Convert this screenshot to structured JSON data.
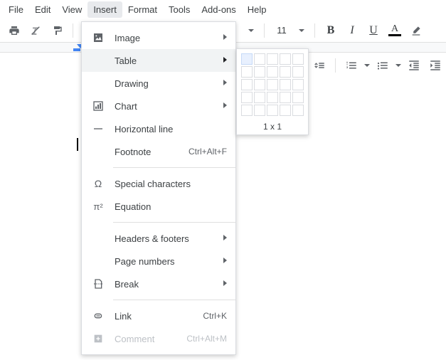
{
  "menubar": {
    "items": [
      {
        "label": "File"
      },
      {
        "label": "Edit"
      },
      {
        "label": "View"
      },
      {
        "label": "Insert"
      },
      {
        "label": "Format"
      },
      {
        "label": "Tools"
      },
      {
        "label": "Add-ons"
      },
      {
        "label": "Help"
      }
    ],
    "active_index": 3
  },
  "toolbar": {
    "font_size": "11"
  },
  "insert_menu": {
    "image": "Image",
    "table": "Table",
    "drawing": "Drawing",
    "chart": "Chart",
    "horizontal_line": "Horizontal line",
    "footnote": "Footnote",
    "footnote_shortcut": "Ctrl+Alt+F",
    "special_characters": "Special characters",
    "equation": "Equation",
    "headers_footers": "Headers & footers",
    "page_numbers": "Page numbers",
    "break": "Break",
    "link": "Link",
    "link_shortcut": "Ctrl+K",
    "comment": "Comment",
    "comment_shortcut": "Ctrl+Alt+M"
  },
  "table_submenu": {
    "rows": 1,
    "cols": 1,
    "dim_label": "1 x 1"
  }
}
